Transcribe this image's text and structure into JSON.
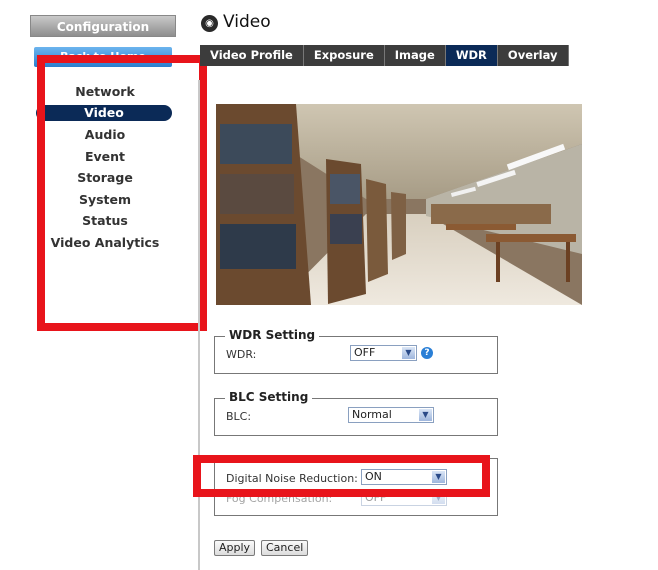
{
  "sidebar": {
    "config_label": "Configuration",
    "back_label": "Back to Home",
    "items": [
      "Network",
      "Video",
      "Audio",
      "Event",
      "Storage",
      "System",
      "Status",
      "Video Analytics"
    ],
    "active_item": "Video"
  },
  "header": {
    "title": "Video",
    "icon": "video-circle-icon"
  },
  "tabs": [
    "Video Profile",
    "Exposure",
    "Image",
    "WDR",
    "Overlay"
  ],
  "active_tab": "WDR",
  "wdr": {
    "legend": "WDR Setting",
    "label": "WDR:",
    "value": "OFF",
    "help": "?"
  },
  "blc": {
    "legend": "BLC Setting",
    "label": "BLC:",
    "value": "Normal"
  },
  "advanced": {
    "dnr_label": "Digital Noise Reduction:",
    "dnr_value": "ON",
    "fog_label": "Fog Compensation:",
    "fog_value": "OFF"
  },
  "buttons": {
    "apply": "Apply",
    "cancel": "Cancel"
  },
  "colors": {
    "highlight": "#e8141b",
    "active_nav": "#0b2a57",
    "tab_bar": "#3c3c3c"
  }
}
